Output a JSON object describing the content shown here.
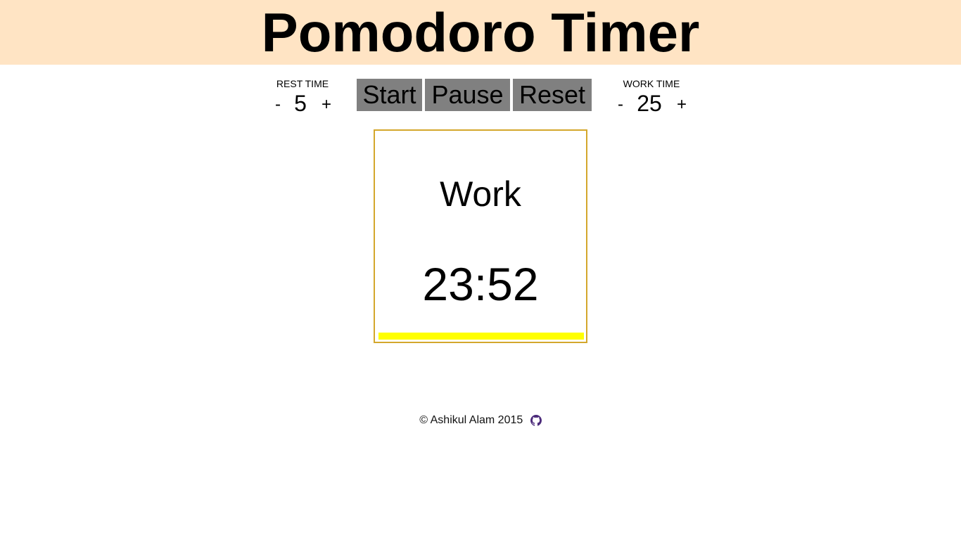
{
  "header": {
    "title": "Pomodoro Timer"
  },
  "rest": {
    "label": "REST TIME",
    "minus": "-",
    "value": "5",
    "plus": "+"
  },
  "work": {
    "label": "WORK TIME",
    "minus": "-",
    "value": "25",
    "plus": "+"
  },
  "controls": {
    "start_label": "Start",
    "pause_label": "Pause",
    "reset_label": "Reset"
  },
  "timer": {
    "mode": "Work",
    "time": "23:52",
    "progress_fraction": 1.0,
    "progress_color": "#ffff00",
    "border_color": "#d4a72c"
  },
  "footer": {
    "copyright": "© Ashikul Alam 2015",
    "link_icon": "github-icon"
  },
  "colors": {
    "header_bg": "#ffe4c4",
    "button_bg": "#808080"
  }
}
